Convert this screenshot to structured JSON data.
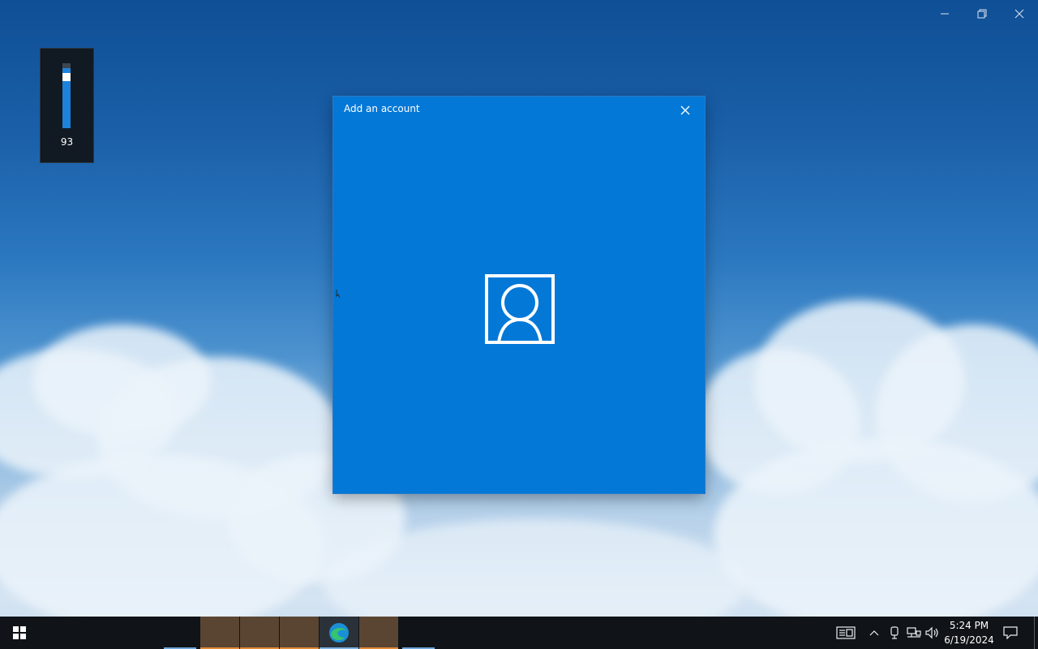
{
  "desktop": {
    "window_controls": [
      "minimize-icon",
      "restore-icon",
      "close-icon"
    ]
  },
  "volume_flyout": {
    "value": "93",
    "level_percent": 93
  },
  "dialog": {
    "title": "Add an account",
    "close_icon": "close-icon",
    "center_icon": "account-icon"
  },
  "taskbar": {
    "start_icon": "windows-logo-icon",
    "apps": [
      "app-1",
      "app-2",
      "app-3",
      "edge-icon",
      "app-5"
    ],
    "tray_icons": [
      "news-widget-icon",
      "chevron-up-icon",
      "meet-icon",
      "network-icon",
      "volume-icon"
    ],
    "time": "5:24 PM",
    "date": "6/19/2024",
    "notification_icon": "notification-icon"
  },
  "colors": {
    "dialog_bg": "#0478d7",
    "taskbar_bg": "#101418",
    "accent": "#1e82db"
  }
}
